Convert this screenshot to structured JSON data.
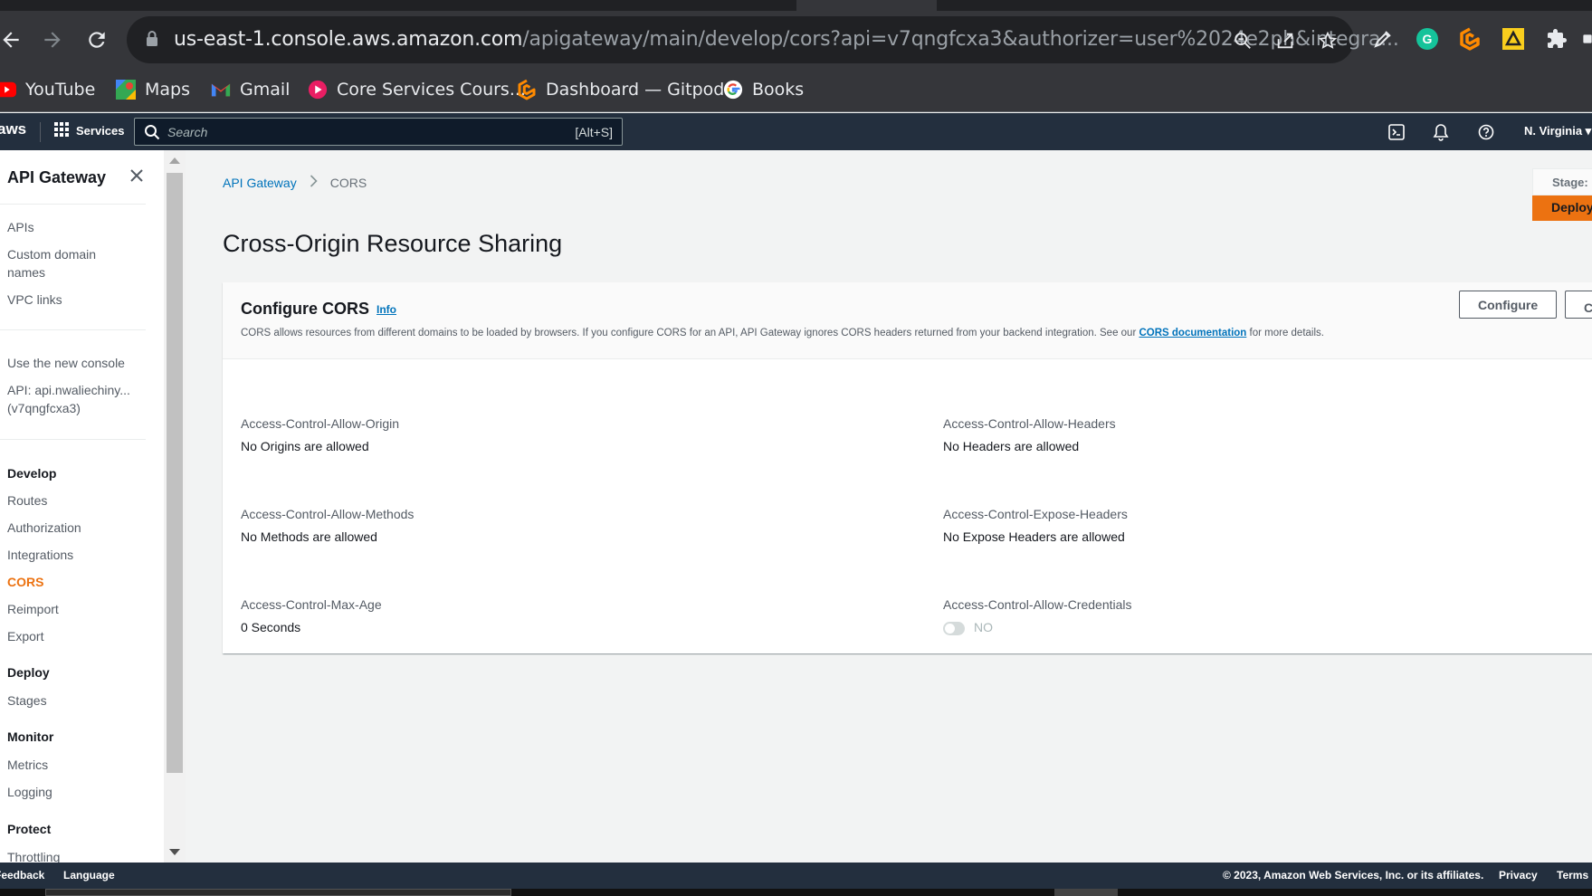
{
  "browser": {
    "url_host": "us-east-1.console.aws.amazon.com",
    "url_path": "/apigateway/main/develop/cors?api=v7qngfcxa3&authorizer=user%2024e2ph&integra...",
    "bookmarks": [
      {
        "label": "YouTube",
        "icon": "youtube-icon"
      },
      {
        "label": "Maps",
        "icon": "maps-icon"
      },
      {
        "label": "Gmail",
        "icon": "gmail-icon"
      },
      {
        "label": "Core Services Cours...",
        "icon": "core-services-icon"
      },
      {
        "label": "Dashboard — Gitpod",
        "icon": "gitpod-icon"
      },
      {
        "label": "Books",
        "icon": "google-icon"
      }
    ]
  },
  "aws_header": {
    "logo": "aws",
    "services_label": "Services",
    "search_placeholder": "Search",
    "search_shortcut": "[Alt+S]",
    "region": "N. Virginia ▾"
  },
  "sidebar": {
    "title": "API Gateway",
    "top_links": [
      "APIs",
      "Custom domain names",
      "VPC links"
    ],
    "new_console": "Use the new console",
    "api_name": "API: api.nwaliechiny... (v7qngfcxa3)",
    "sections": [
      {
        "heading": "Develop",
        "items": [
          "Routes",
          "Authorization",
          "Integrations",
          "CORS",
          "Reimport",
          "Export"
        ]
      },
      {
        "heading": "Deploy",
        "items": [
          "Stages"
        ]
      },
      {
        "heading": "Monitor",
        "items": [
          "Metrics",
          "Logging"
        ]
      },
      {
        "heading": "Protect",
        "items": [
          "Throttling"
        ]
      }
    ],
    "active_item": "CORS"
  },
  "main": {
    "breadcrumb": {
      "root": "API Gateway",
      "current": "CORS"
    },
    "title": "Cross-Origin Resource Sharing",
    "stage_label": "Stage:",
    "deploy_label": "Deploy",
    "panel": {
      "title": "Configure CORS",
      "info": "Info",
      "desc_before": "CORS allows resources from different domains to be loaded by browsers. If you configure CORS for an API, API Gateway ignores CORS headers returned from your backend integration. See our ",
      "desc_link": "CORS documentation",
      "desc_after": " for more details.",
      "configure_button": "Configure",
      "clear_button": "Clear",
      "fields": [
        {
          "key": "Access-Control-Allow-Origin",
          "value": "No Origins are allowed"
        },
        {
          "key": "Access-Control-Allow-Headers",
          "value": "No Headers are allowed"
        },
        {
          "key": "Access-Control-Allow-Methods",
          "value": "No Methods are allowed"
        },
        {
          "key": "Access-Control-Expose-Headers",
          "value": "No Expose Headers are allowed"
        },
        {
          "key": "Access-Control-Max-Age",
          "value": "0 Seconds"
        },
        {
          "key": "Access-Control-Allow-Credentials",
          "value": "NO"
        }
      ]
    }
  },
  "footer": {
    "feedback": "Feedback",
    "language": "Language",
    "copyright": "© 2023, Amazon Web Services, Inc. or its affiliates.",
    "privacy": "Privacy",
    "terms": "Terms"
  },
  "colors": {
    "aws_orange": "#ec7211",
    "aws_navy": "#232f3e",
    "link_blue": "#0073bb"
  }
}
